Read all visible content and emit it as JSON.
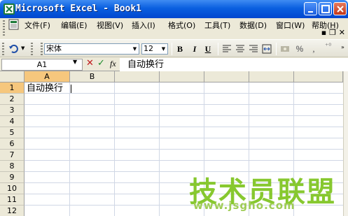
{
  "window": {
    "title": "Microsoft Excel - Book1"
  },
  "menu": {
    "items": [
      "文件(F)",
      "编辑(E)",
      "视图(V)",
      "插入(I)",
      "格式(O)",
      "工具(T)",
      "数据(D)",
      "窗口(W)",
      "帮助(H)"
    ],
    "restore_label": "▪ ❐ ✕"
  },
  "toolbar": {
    "font_name": "宋体",
    "font_size": "12",
    "bold_label": "B",
    "italic_label": "I",
    "underline_label": "U",
    "percent_label": "%",
    "comma_label": ","
  },
  "formula_bar": {
    "name_box": "A1",
    "fx_label": "fx",
    "content": "自动换行"
  },
  "grid": {
    "active_column": "A",
    "columns": [
      "A",
      "B"
    ],
    "rows": [
      "1",
      "2",
      "3",
      "4",
      "5",
      "6",
      "7",
      "8",
      "9",
      "10",
      "11",
      "12"
    ],
    "active_row": "1",
    "cell_a1": "自动换行"
  },
  "watermark": {
    "title": "技术员联盟",
    "url": "www.jsgho.com"
  },
  "colors": {
    "titlebar": "#0a5fe0",
    "active_header": "#f6c77d",
    "watermark": "#7ec420"
  }
}
